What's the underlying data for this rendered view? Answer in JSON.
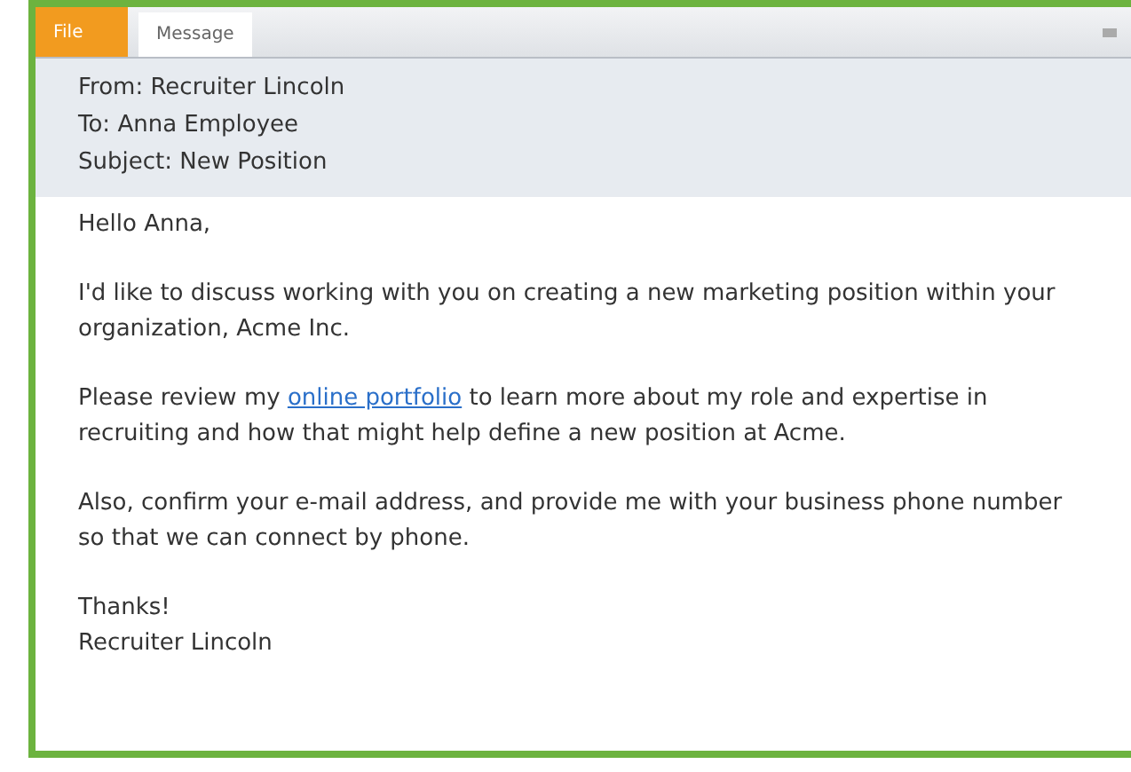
{
  "tabs": [
    {
      "label": "File",
      "kind": "file",
      "selected": false
    },
    {
      "label": "Message",
      "kind": "tab",
      "selected": true
    }
  ],
  "header": {
    "from": "From: Recruiter Lincoln",
    "to": "To: Anna Employee",
    "subject": "Subject: New Position"
  },
  "body": [
    {
      "kind": "text",
      "text": "Hello Anna,"
    },
    {
      "kind": "text",
      "text": "I'd like to discuss working with you on creating a new marketing position within your organization, Acme Inc."
    },
    {
      "kind": "link",
      "before": "Please review my ",
      "link": "online portfolio",
      "after": " to learn more about my role and expertise in recruiting and how that might help define a new position at Acme."
    },
    {
      "kind": "text",
      "text": "Also, confirm your e-mail address, and provide me with your business phone number so that we can connect by phone."
    },
    {
      "kind": "lines",
      "lines": [
        "Thanks!",
        "Recruiter Lincoln"
      ]
    }
  ]
}
